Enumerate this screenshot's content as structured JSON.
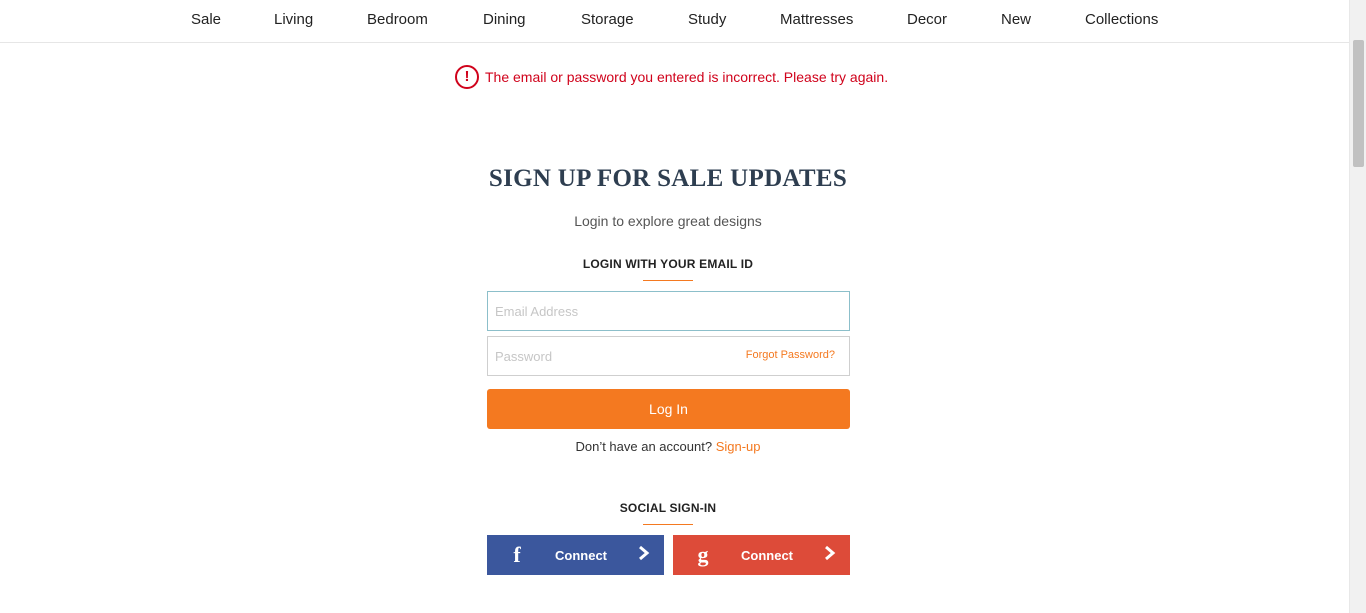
{
  "nav": {
    "items": [
      {
        "label": "Sale"
      },
      {
        "label": "Living"
      },
      {
        "label": "Bedroom"
      },
      {
        "label": "Dining"
      },
      {
        "label": "Storage"
      },
      {
        "label": "Study"
      },
      {
        "label": "Mattresses"
      },
      {
        "label": "Decor"
      },
      {
        "label": "New"
      },
      {
        "label": "Collections"
      }
    ]
  },
  "error": {
    "icon": "exclamation-circle-icon",
    "message": "The email or password you entered is incorrect. Please try again."
  },
  "login": {
    "title": "SIGN UP FOR SALE UPDATES",
    "subtitle": "Login to explore great designs",
    "email_heading": "LOGIN WITH YOUR EMAIL ID",
    "email_placeholder": "Email Address",
    "email_value": "",
    "password_placeholder": "Password",
    "password_value": "",
    "forgot_label": "Forgot Password?",
    "login_button": "Log In",
    "no_account_text": "Don’t have an account?",
    "signup_link": "Sign-up",
    "social_heading": "SOCIAL SIGN-IN",
    "facebook": {
      "logo": "f",
      "label": "Connect",
      "icon": "facebook-icon"
    },
    "google": {
      "logo": "g",
      "label": "Connect",
      "icon": "google-icon"
    }
  },
  "colors": {
    "accent": "#f47920",
    "error": "#d0021b",
    "facebook": "#3b579d",
    "google": "#dd4b39"
  }
}
